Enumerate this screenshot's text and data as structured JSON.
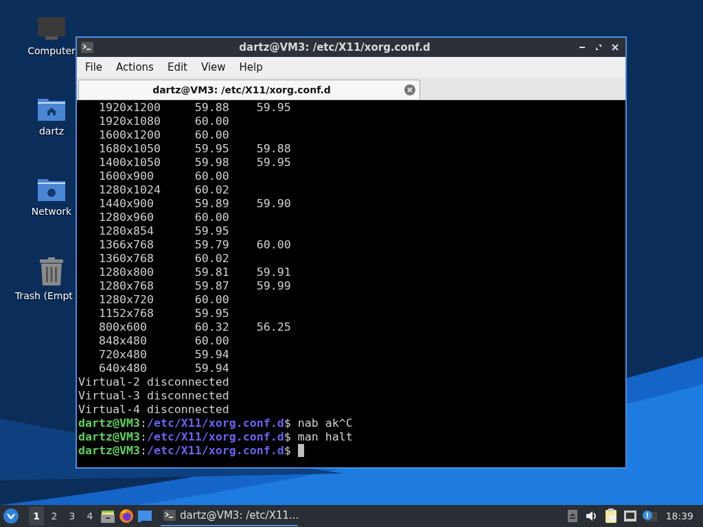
{
  "desktop": {
    "icons": [
      {
        "kind": "computer",
        "label": "Computer"
      },
      {
        "kind": "home",
        "label": "dartz"
      },
      {
        "kind": "network",
        "label": "Network"
      },
      {
        "kind": "trash",
        "label": "Trash (Empt"
      }
    ]
  },
  "window": {
    "title": "dartz@VM3: /etc/X11/xorg.conf.d",
    "menu": [
      "File",
      "Actions",
      "Edit",
      "View",
      "Help"
    ],
    "tabs": [
      {
        "label": "dartz@VM3: /etc/X11/xorg.conf.d",
        "selected": true
      }
    ],
    "terminal": {
      "lines": [
        {
          "kind": "output",
          "text": "   1920x1200     59.88    59.95"
        },
        {
          "kind": "output",
          "text": "   1920x1080     60.00"
        },
        {
          "kind": "output",
          "text": "   1600x1200     60.00"
        },
        {
          "kind": "output",
          "text": "   1680x1050     59.95    59.88"
        },
        {
          "kind": "output",
          "text": "   1400x1050     59.98    59.95"
        },
        {
          "kind": "output",
          "text": "   1600x900      60.00"
        },
        {
          "kind": "output",
          "text": "   1280x1024     60.02"
        },
        {
          "kind": "output",
          "text": "   1440x900      59.89    59.90"
        },
        {
          "kind": "output",
          "text": "   1280x960      60.00"
        },
        {
          "kind": "output",
          "text": "   1280x854      59.95"
        },
        {
          "kind": "output",
          "text": "   1366x768      59.79    60.00"
        },
        {
          "kind": "output",
          "text": "   1360x768      60.02"
        },
        {
          "kind": "output",
          "text": "   1280x800      59.81    59.91"
        },
        {
          "kind": "output",
          "text": "   1280x768      59.87    59.99"
        },
        {
          "kind": "output",
          "text": "   1280x720      60.00"
        },
        {
          "kind": "output",
          "text": "   1152x768      59.95"
        },
        {
          "kind": "output",
          "text": "   800x600       60.32    56.25"
        },
        {
          "kind": "output",
          "text": "   848x480       60.00"
        },
        {
          "kind": "output",
          "text": "   720x480       59.94"
        },
        {
          "kind": "output",
          "text": "   640x480       59.94"
        },
        {
          "kind": "output",
          "text": "Virtual-2 disconnected"
        },
        {
          "kind": "output",
          "text": "Virtual-3 disconnected"
        },
        {
          "kind": "output",
          "text": "Virtual-4 disconnected"
        },
        {
          "kind": "prompt",
          "user": "dartz@VM3",
          "separator": ":",
          "path": "/etc/X11/xorg.conf.d",
          "symbol": "$",
          "command": "nab ak^C",
          "cursor": false
        },
        {
          "kind": "prompt",
          "user": "dartz@VM3",
          "separator": ":",
          "path": "/etc/X11/xorg.conf.d",
          "symbol": "$",
          "command": "man halt",
          "cursor": false
        },
        {
          "kind": "prompt",
          "user": "dartz@VM3",
          "separator": ":",
          "path": "/etc/X11/xorg.conf.d",
          "symbol": "$",
          "cursor": true
        }
      ]
    }
  },
  "taskbar": {
    "workspaces": [
      {
        "label": "1",
        "selected": true
      },
      {
        "label": "2",
        "selected": false
      },
      {
        "label": "3",
        "selected": false
      },
      {
        "label": "4",
        "selected": false
      }
    ],
    "tasks": [
      {
        "label": "dartz@VM3: /etc/X11...",
        "active": true
      }
    ],
    "clock": "18:39"
  }
}
